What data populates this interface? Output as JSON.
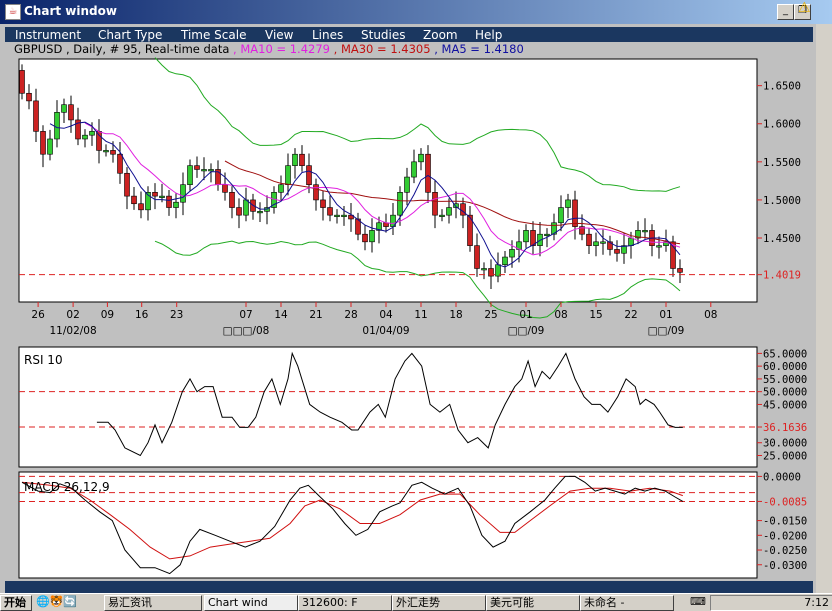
{
  "window": {
    "title": "Chart window",
    "minimize": "_",
    "restore": "❐"
  },
  "menu": [
    "Instrument",
    "Chart Type",
    "Time Scale",
    "View",
    "Lines",
    "Studies",
    "Zoom",
    "Help"
  ],
  "info": {
    "instrument": "GBPUSD , Daily, # 95, Real-time data",
    "ma10": " , MA10 = 1.4279",
    "ma30": " , MA30 = 1.4305",
    "ma5": " , MA5 = 1.4180"
  },
  "colors": {
    "up": "#33cc33",
    "down": "#cc2222",
    "ma10": "#e020e0",
    "ma30": "#a01010",
    "ma5": "#101090",
    "bands": "#22aa22",
    "ref": "#dd2222"
  },
  "chart_data": [
    {
      "type": "candlestick",
      "title": "GBPUSD Daily",
      "count": 95,
      "first_open": 1.67,
      "closes": [
        1.64,
        1.63,
        1.59,
        1.56,
        1.58,
        1.615,
        1.625,
        1.605,
        1.58,
        1.585,
        1.59,
        1.565,
        1.565,
        1.56,
        1.535,
        1.505,
        1.495,
        1.487,
        1.51,
        1.505,
        1.505,
        1.49,
        1.497,
        1.52,
        1.545,
        1.54,
        1.54,
        1.54,
        1.52,
        1.51,
        1.49,
        1.48,
        1.5,
        1.485,
        1.485,
        1.49,
        1.51,
        1.52,
        1.545,
        1.56,
        1.545,
        1.52,
        1.5,
        1.49,
        1.48,
        1.48,
        1.48,
        1.475,
        1.455,
        1.445,
        1.46,
        1.47,
        1.465,
        1.48,
        1.51,
        1.53,
        1.55,
        1.56,
        1.51,
        1.48,
        1.48,
        1.49,
        1.495,
        1.48,
        1.44,
        1.41,
        1.41,
        1.4,
        1.415,
        1.425,
        1.435,
        1.445,
        1.46,
        1.44,
        1.455,
        1.455,
        1.47,
        1.49,
        1.5,
        1.465,
        1.455,
        1.44,
        1.445,
        1.445,
        1.435,
        1.43,
        1.44,
        1.45,
        1.46,
        1.46,
        1.44,
        1.44,
        1.445,
        1.41,
        1.405
      ],
      "ylim": [
        1.366,
        1.685
      ],
      "yticks": [
        "1.6500",
        "1.6000",
        "1.5500",
        "1.5000",
        "1.4500"
      ],
      "ref_line": "1.4019",
      "xticks": [
        {
          "i": 2.3,
          "label": "26"
        },
        {
          "i": 7.3,
          "label": "02"
        },
        {
          "i": 12.2,
          "label": "09"
        },
        {
          "i": 17.1,
          "label": "16"
        },
        {
          "i": 22.1,
          "label": "23"
        },
        {
          "i": 32,
          "label": "07"
        },
        {
          "i": 37,
          "label": "14"
        },
        {
          "i": 42,
          "label": "21"
        },
        {
          "i": 47,
          "label": "28"
        },
        {
          "i": 52,
          "label": "04"
        },
        {
          "i": 57,
          "label": "11"
        },
        {
          "i": 62,
          "label": "18"
        },
        {
          "i": 67,
          "label": "25"
        },
        {
          "i": 72,
          "label": "01"
        },
        {
          "i": 77,
          "label": "08"
        },
        {
          "i": 82,
          "label": "15"
        },
        {
          "i": 87,
          "label": "22"
        },
        {
          "i": 92,
          "label": "01"
        },
        {
          "i": 98.4,
          "label": "08"
        }
      ],
      "xdates": [
        {
          "i": 7.3,
          "label": "11/02/08"
        },
        {
          "i": 32,
          "label": "□□□/08"
        },
        {
          "i": 52,
          "label": "01/04/09"
        },
        {
          "i": 72,
          "label": "□□/09"
        },
        {
          "i": 92,
          "label": "□□/09"
        }
      ]
    },
    {
      "type": "line",
      "title": "RSI 10",
      "ylim": [
        20.5,
        67.5
      ],
      "yticks": [
        "65.0000",
        "60.0000",
        "55.0000",
        "50.0000",
        "45.0000",
        "30.0000",
        "25.0000"
      ],
      "ref_lines": [
        "50.0000",
        "36.1636"
      ],
      "points": [
        [
          10.7,
          38
        ],
        [
          12.3,
          38
        ],
        [
          13.3,
          35
        ],
        [
          14.7,
          28
        ],
        [
          16.9,
          25
        ],
        [
          18,
          30
        ],
        [
          19,
          37
        ],
        [
          20,
          30
        ],
        [
          21.4,
          38
        ],
        [
          22.9,
          50
        ],
        [
          24,
          55
        ],
        [
          25,
          50
        ],
        [
          26.1,
          52
        ],
        [
          27.3,
          52
        ],
        [
          28.6,
          40
        ],
        [
          30,
          40
        ],
        [
          31.1,
          36
        ],
        [
          32.3,
          36
        ],
        [
          33.4,
          40
        ],
        [
          34.6,
          50
        ],
        [
          35.7,
          55
        ],
        [
          36.9,
          45
        ],
        [
          38,
          55
        ],
        [
          38.6,
          65
        ],
        [
          39.4,
          60
        ],
        [
          41.1,
          45
        ],
        [
          42.6,
          42
        ],
        [
          44,
          40
        ],
        [
          45.7,
          38
        ],
        [
          47.1,
          35
        ],
        [
          48,
          35
        ],
        [
          49.7,
          42
        ],
        [
          50.9,
          45
        ],
        [
          51.9,
          40
        ],
        [
          53.3,
          55
        ],
        [
          54.7,
          62
        ],
        [
          55.7,
          65
        ],
        [
          57.1,
          60
        ],
        [
          58.3,
          45
        ],
        [
          59.7,
          42
        ],
        [
          61.1,
          45
        ],
        [
          62.3,
          35
        ],
        [
          63.7,
          30
        ],
        [
          65.1,
          32
        ],
        [
          66.6,
          28
        ],
        [
          67.6,
          37
        ],
        [
          69,
          45
        ],
        [
          70.4,
          52
        ],
        [
          71.4,
          55
        ],
        [
          72.3,
          62
        ],
        [
          73.3,
          52
        ],
        [
          74.3,
          58
        ],
        [
          75.4,
          55
        ],
        [
          76.6,
          60
        ],
        [
          77.7,
          65
        ],
        [
          79,
          55
        ],
        [
          80.3,
          48
        ],
        [
          81.4,
          45
        ],
        [
          82.6,
          45
        ],
        [
          83.7,
          42
        ],
        [
          85.1,
          48
        ],
        [
          86.3,
          55
        ],
        [
          87.6,
          52
        ],
        [
          88.3,
          45
        ],
        [
          89.1,
          47
        ],
        [
          90.3,
          45
        ],
        [
          91.1,
          42
        ],
        [
          92.3,
          37
        ],
        [
          93.3,
          36
        ],
        [
          94.4,
          36
        ]
      ]
    },
    {
      "type": "line",
      "title": "MACD 26,12,9",
      "ylim": [
        -0.0345,
        0.0015
      ],
      "yticks": [
        "0.0000",
        "-0.0150",
        "-0.0200",
        "-0.0250",
        "-0.0300"
      ],
      "ref_lines": [
        "0.0000",
        "-0.0085"
      ],
      "extra_ref": -0.0055,
      "macd": [
        [
          0,
          -0.002
        ],
        [
          2.3,
          -0.005
        ],
        [
          4,
          -0.0055
        ],
        [
          5.4,
          -0.0025
        ],
        [
          7.1,
          -0.004
        ],
        [
          9,
          -0.008
        ],
        [
          11.1,
          -0.012
        ],
        [
          12.9,
          -0.015
        ],
        [
          14.7,
          -0.025
        ],
        [
          16.9,
          -0.031
        ],
        [
          19,
          -0.031
        ],
        [
          21.1,
          -0.033
        ],
        [
          22.6,
          -0.03
        ],
        [
          24,
          -0.022
        ],
        [
          25.4,
          -0.018
        ],
        [
          27.6,
          -0.02
        ],
        [
          29.7,
          -0.022
        ],
        [
          31.9,
          -0.024
        ],
        [
          34,
          -0.022
        ],
        [
          36.1,
          -0.017
        ],
        [
          38.3,
          -0.008
        ],
        [
          39.7,
          -0.004
        ],
        [
          40.9,
          -0.003
        ],
        [
          42.6,
          -0.007
        ],
        [
          44.4,
          -0.011
        ],
        [
          46.1,
          -0.016
        ],
        [
          47.7,
          -0.02
        ],
        [
          49.4,
          -0.018
        ],
        [
          51.1,
          -0.012
        ],
        [
          52.9,
          -0.01
        ],
        [
          54,
          -0.009
        ],
        [
          55.7,
          -0.003
        ],
        [
          57.1,
          -0.002
        ],
        [
          58.6,
          -0.004
        ],
        [
          60.4,
          -0.006
        ],
        [
          62.3,
          -0.004
        ],
        [
          64,
          -0.01
        ],
        [
          65.7,
          -0.02
        ],
        [
          67.3,
          -0.024
        ],
        [
          69,
          -0.022
        ],
        [
          70.4,
          -0.016
        ],
        [
          72.6,
          -0.012
        ],
        [
          74.7,
          -0.008
        ],
        [
          76.1,
          -0.004
        ],
        [
          77.6,
          0
        ],
        [
          79,
          0
        ],
        [
          80.4,
          -0.002
        ],
        [
          81.9,
          -0.005
        ],
        [
          83.3,
          -0.004
        ],
        [
          84.7,
          -0.005
        ],
        [
          86.1,
          -0.006
        ],
        [
          87.6,
          -0.004
        ],
        [
          89,
          -0.005
        ],
        [
          90.4,
          -0.004
        ],
        [
          91.9,
          -0.005
        ],
        [
          93.3,
          -0.007
        ],
        [
          94.4,
          -0.0085
        ]
      ],
      "signal": [
        [
          0,
          -0.002
        ],
        [
          4,
          -0.003
        ],
        [
          6.9,
          -0.004
        ],
        [
          9.7,
          -0.008
        ],
        [
          12.6,
          -0.013
        ],
        [
          15.4,
          -0.018
        ],
        [
          18.3,
          -0.024
        ],
        [
          21.1,
          -0.028
        ],
        [
          24,
          -0.027
        ],
        [
          26.9,
          -0.024
        ],
        [
          29.7,
          -0.023
        ],
        [
          32.6,
          -0.022
        ],
        [
          35.4,
          -0.021
        ],
        [
          38.3,
          -0.016
        ],
        [
          40.4,
          -0.01
        ],
        [
          42.6,
          -0.008
        ],
        [
          45.4,
          -0.011
        ],
        [
          48.3,
          -0.016
        ],
        [
          51.1,
          -0.016
        ],
        [
          54,
          -0.013
        ],
        [
          56.9,
          -0.008
        ],
        [
          59.7,
          -0.006
        ],
        [
          62.6,
          -0.006
        ],
        [
          65.4,
          -0.013
        ],
        [
          68.3,
          -0.019
        ],
        [
          70.4,
          -0.019
        ],
        [
          72.6,
          -0.015
        ],
        [
          75.4,
          -0.01
        ],
        [
          78.3,
          -0.005
        ],
        [
          81.1,
          -0.004
        ],
        [
          84,
          -0.004
        ],
        [
          86.9,
          -0.005
        ],
        [
          89.7,
          -0.004
        ],
        [
          92.6,
          -0.005
        ],
        [
          94.4,
          -0.0065
        ]
      ]
    }
  ],
  "taskbar": {
    "start": "开始",
    "items": [
      "易汇资讯",
      "Chart wind",
      "312600: F",
      "外汇走势",
      "美元可能",
      "未命名 -"
    ],
    "time": "7:12"
  }
}
